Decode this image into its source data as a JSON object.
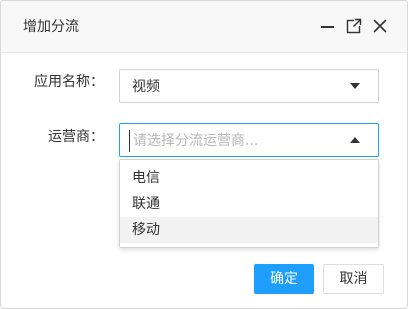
{
  "dialog": {
    "title": "增加分流",
    "controls": [
      "minimize-icon",
      "maximize-icon",
      "close-icon"
    ]
  },
  "form": {
    "app_name": {
      "label": "应用名称：",
      "value": "视频"
    },
    "operator": {
      "label": "运营商：",
      "value": "",
      "placeholder": "请选择分流运营商...",
      "dropdown_open": true,
      "options": [
        "电信",
        "联通",
        "移动"
      ],
      "highlighted_option": "移动"
    }
  },
  "buttons": {
    "confirm": "确定",
    "cancel": "取消"
  },
  "colors": {
    "primary": "#1e9fff",
    "titlebar_bg": "#f8f8f8",
    "border": "#d2d2d2"
  }
}
